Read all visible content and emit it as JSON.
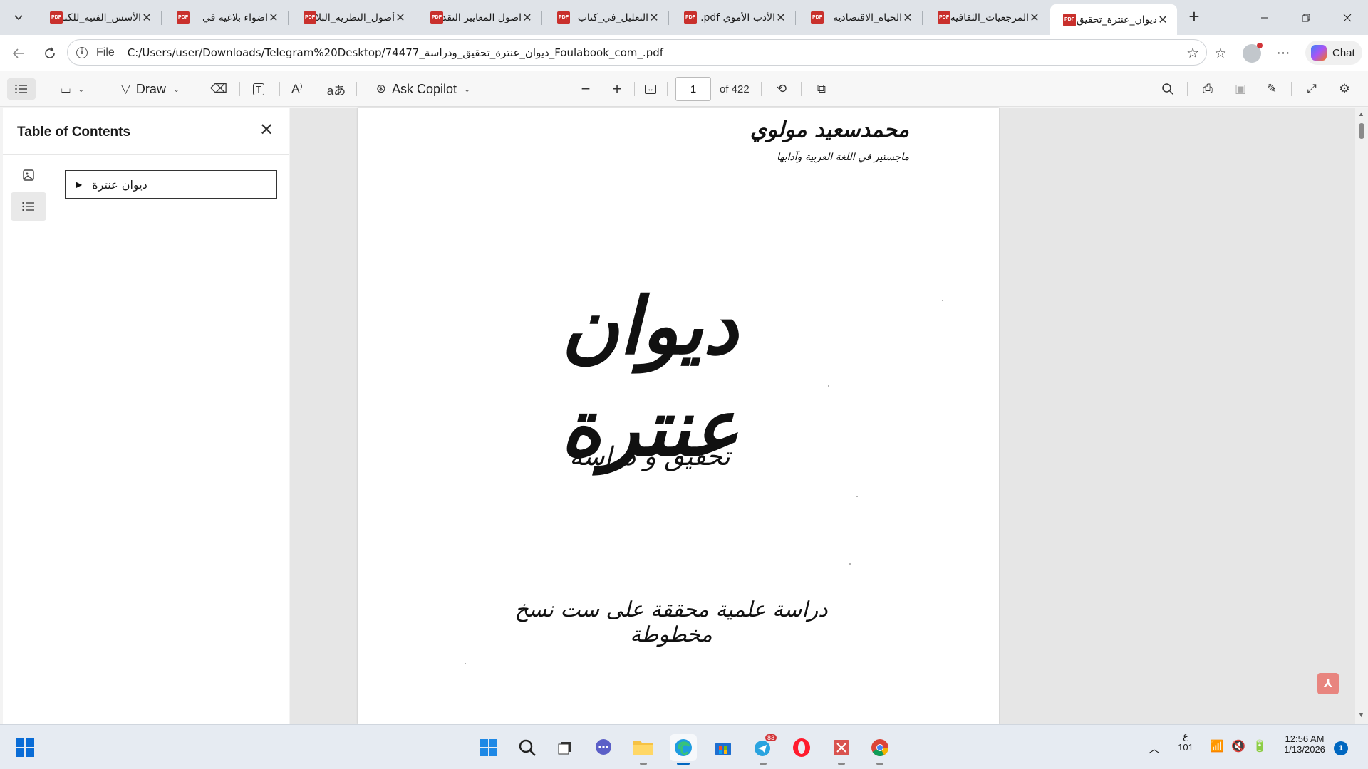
{
  "browser": {
    "tabs": [
      {
        "title": "الأسس_الفنية_للكتابة",
        "active": false
      },
      {
        "title": "اضواء بلاغية في",
        "active": false
      },
      {
        "title": "أصول_النظرية_البلاغية",
        "active": false
      },
      {
        "title": "اصول المعايير النقدية",
        "active": false
      },
      {
        "title": "التعليل_في_كتاب",
        "active": false
      },
      {
        "title": "الأدب الأموي pdf.",
        "active": false
      },
      {
        "title": "الحياة_الاقتصادية",
        "active": false
      },
      {
        "title": "المرجعيات_الثقافية",
        "active": false
      },
      {
        "title": "ديوان_عنترة_تحقيق",
        "active": true
      }
    ],
    "url_scheme": "File",
    "url": "C:/Users/user/Downloads/Telegram%20Desktop/74477_ديوان_عنترة_تحقيق_ودراسة_Foulabook_com_.pdf",
    "chat_label": "Chat"
  },
  "pdf_toolbar": {
    "draw_label": "Draw",
    "copilot_label": "Ask Copilot",
    "page_number": "1",
    "page_total": "of 422"
  },
  "toc": {
    "title": "Table of Contents",
    "items": [
      {
        "label": "ديوان عنترة"
      }
    ]
  },
  "document": {
    "author": "محمدسعيد مولوي",
    "author_subtitle": "ماجستير في اللغة العربية وآدابها",
    "title": "ديوان عنترة",
    "subtitle": "تحقيق و دراسة",
    "note": "دراسة علمية محققة على ست نسخ مخطوطة"
  },
  "taskbar": {
    "keyboard_lang": "ع",
    "keyboard_code": "101",
    "time": "12:56 AM",
    "date": "1/13/2026",
    "notification_count": "1",
    "telegram_badge": "83"
  },
  "colors": {
    "tabstrip_bg": "#dfe3e8",
    "pdf_badge": "#c9302c",
    "accent": "#0067c0",
    "viewer_bg": "#e6e6e6"
  }
}
